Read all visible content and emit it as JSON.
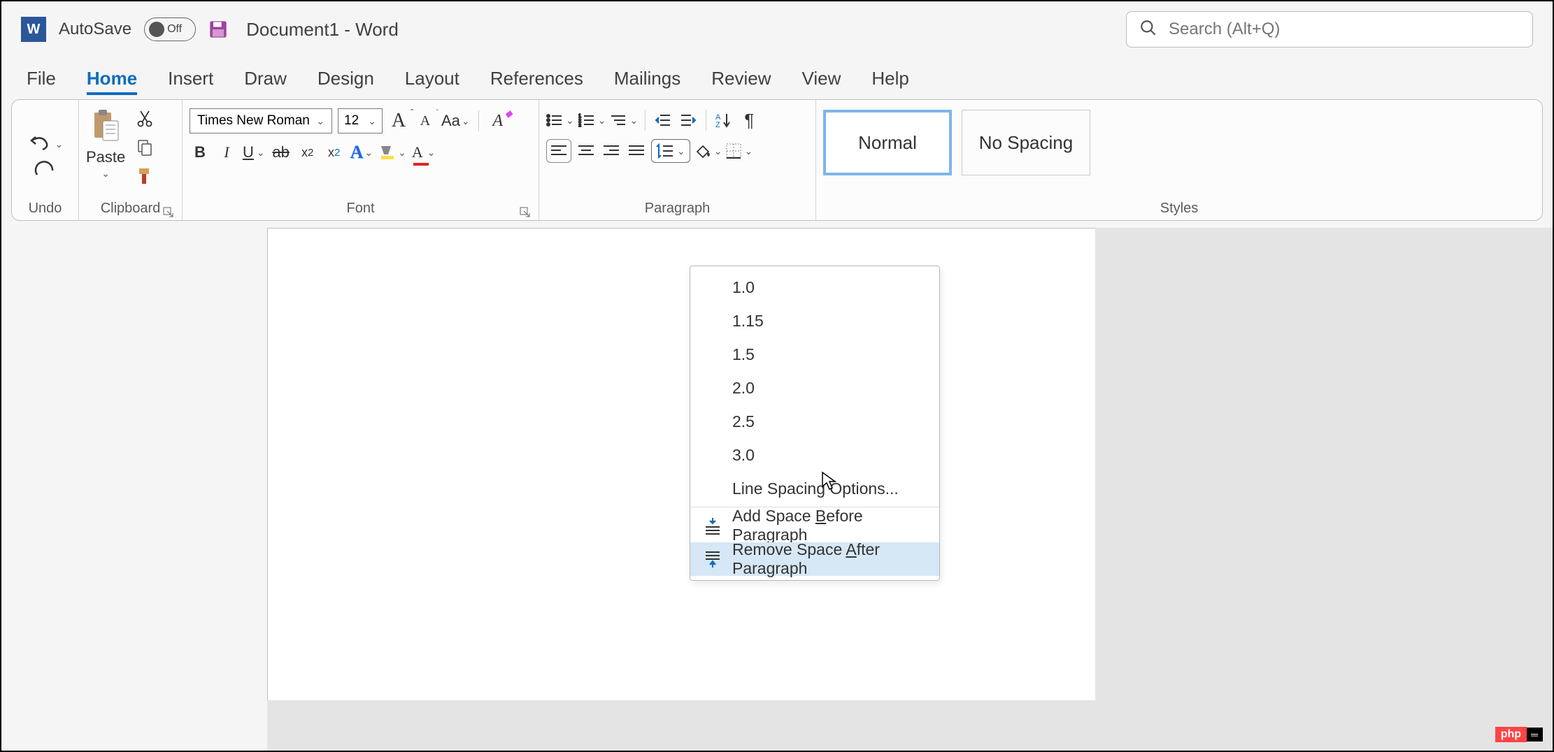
{
  "titlebar": {
    "autosave_label": "AutoSave",
    "autosave_state": "Off",
    "doc_title": "Document1  -  Word",
    "search_placeholder": "Search (Alt+Q)"
  },
  "tabs": [
    "File",
    "Home",
    "Insert",
    "Draw",
    "Design",
    "Layout",
    "References",
    "Mailings",
    "Review",
    "View",
    "Help"
  ],
  "active_tab": "Home",
  "ribbon": {
    "undo_label": "Undo",
    "clipboard": {
      "paste_label": "Paste",
      "group_label": "Clipboard"
    },
    "font": {
      "font_name": "Times New Roman",
      "font_size": "12",
      "group_label": "Font"
    },
    "paragraph": {
      "group_label": "Paragraph"
    },
    "styles": {
      "group_label": "Styles",
      "items": [
        {
          "label": "Normal",
          "active": true
        },
        {
          "label": "No Spacing",
          "active": false
        }
      ]
    }
  },
  "dropdown": {
    "values": [
      "1.0",
      "1.15",
      "1.5",
      "2.0",
      "2.5",
      "3.0"
    ],
    "options_label": "Line Spacing Options...",
    "add_before_pre": "Add Space ",
    "add_before_u": "B",
    "add_before_post": "efore Paragraph",
    "remove_after_pre": "Remove Space ",
    "remove_after_u": "A",
    "remove_after_post": "fter Paragraph"
  },
  "php_badge": {
    "left": "php",
    "right": "═"
  }
}
